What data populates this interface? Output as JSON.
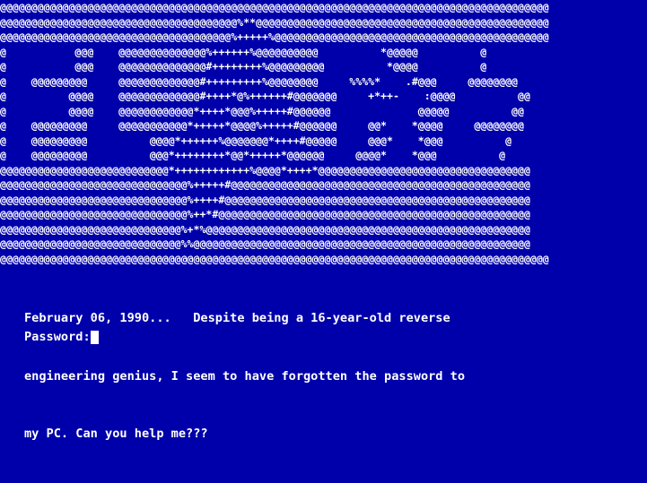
{
  "screen": {
    "background": "#0000aa",
    "foreground": "#ffffff"
  },
  "banner": {
    "rows": [
      "@@@@@@@@@@@@@@@@@@@@@@@@@@@@@@@@@@@@@@@@@@@@@@@@@@@@@@@@@@@@@@@@@@@@@@@@@@@@@@@@@@@@@@@@",
      "@@@@@@@@@@@@@@@@@@@@@@@@@@@@@@@@@@@@@@%**@@@@@@@@@@@@@@@@@@@@@@@@@@@@@@@@@@@@@@@@@@@@@@@",
      "@@@@@@@@@@@@@@@@@@@@@@@@@@@@@@@@@@@@@%+++++%@@@@@@@@@@@@@@@@@@@@@@@@@@@@@@@@@@@@@@@@@@@@",
      "@           @@@    @@@@@@@@@@@@@@%++++++%@@@@@@@@@@          *@@@@@          @",
      "@           @@@    @@@@@@@@@@@@@@#++++++++%@@@@@@@@@          *@@@@          @",
      "@    @@@@@@@@@     @@@@@@@@@@@@@#+++++++++%@@@@@@@@     %%%%*    .#@@@     @@@@@@@@",
      "@          @@@@    @@@@@@@@@@@@@#++++*@%++++++#@@@@@@@     +*++-    :@@@@          @@",
      "@          @@@@    @@@@@@@@@@@@*++++*@@@%+++++#@@@@@@              @@@@@          @@",
      "@    @@@@@@@@@     @@@@@@@@@@@*+++++*@@@@%+++++#@@@@@@     @@*    *@@@@     @@@@@@@@",
      "@    @@@@@@@@@          @@@@*++++++%@@@@@@@*++++#@@@@@     @@@*    *@@@          @",
      "@    @@@@@@@@@          @@@*++++++++*@@*+++++*@@@@@@     @@@@*    *@@@          @",
      "@@@@@@@@@@@@@@@@@@@@@@@@@@@*++++++++++++%@@@@*++++*@@@@@@@@@@@@@@@@@@@@@@@@@@@@@@@@@@",
      "@@@@@@@@@@@@@@@@@@@@@@@@@@@@@@%+++++#@@@@@@@@@@@@@@@@@@@@@@@@@@@@@@@@@@@@@@@@@@@@@@@@",
      "@@@@@@@@@@@@@@@@@@@@@@@@@@@@@@%++++#@@@@@@@@@@@@@@@@@@@@@@@@@@@@@@@@@@@@@@@@@@@@@@@@@",
      "@@@@@@@@@@@@@@@@@@@@@@@@@@@@@@%++*#@@@@@@@@@@@@@@@@@@@@@@@@@@@@@@@@@@@@@@@@@@@@@@@@@@",
      "@@@@@@@@@@@@@@@@@@@@@@@@@@@@@%+*%@@@@@@@@@@@@@@@@@@@@@@@@@@@@@@@@@@@@@@@@@@@@@@@@@@@@",
      "@@@@@@@@@@@@@@@@@@@@@@@@@@@@@%%@@@@@@@@@@@@@@@@@@@@@@@@@@@@@@@@@@@@@@@@@@@@@@@@@@@@@@",
      "@@@@@@@@@@@@@@@@@@@@@@@@@@@@@@@@@@@@@@@@@@@@@@@@@@@@@@@@@@@@@@@@@@@@@@@@@@@@@@@@@@@@@@@@"
    ]
  },
  "message": {
    "line1": "February 06, 1990...   Despite being a 16-year-old reverse",
    "line2": "engineering genius, I seem to have forgotten the password to",
    "line3": "my PC. Can you help me???"
  },
  "password": {
    "label": "Password:",
    "value": ""
  }
}
